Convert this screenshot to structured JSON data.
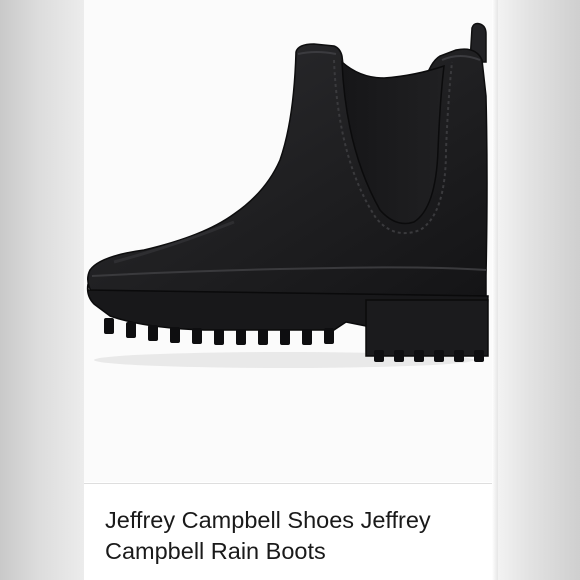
{
  "listing": {
    "title_line1": "Jeffrey Campbell Shoes Jeffrey",
    "title_line2": "Campbell Rain Boots"
  },
  "photo": {
    "subject": "black-chelsea-rain-boot-icon",
    "boot_color": "#1f1f21",
    "background_color": "#fbfbfb"
  }
}
